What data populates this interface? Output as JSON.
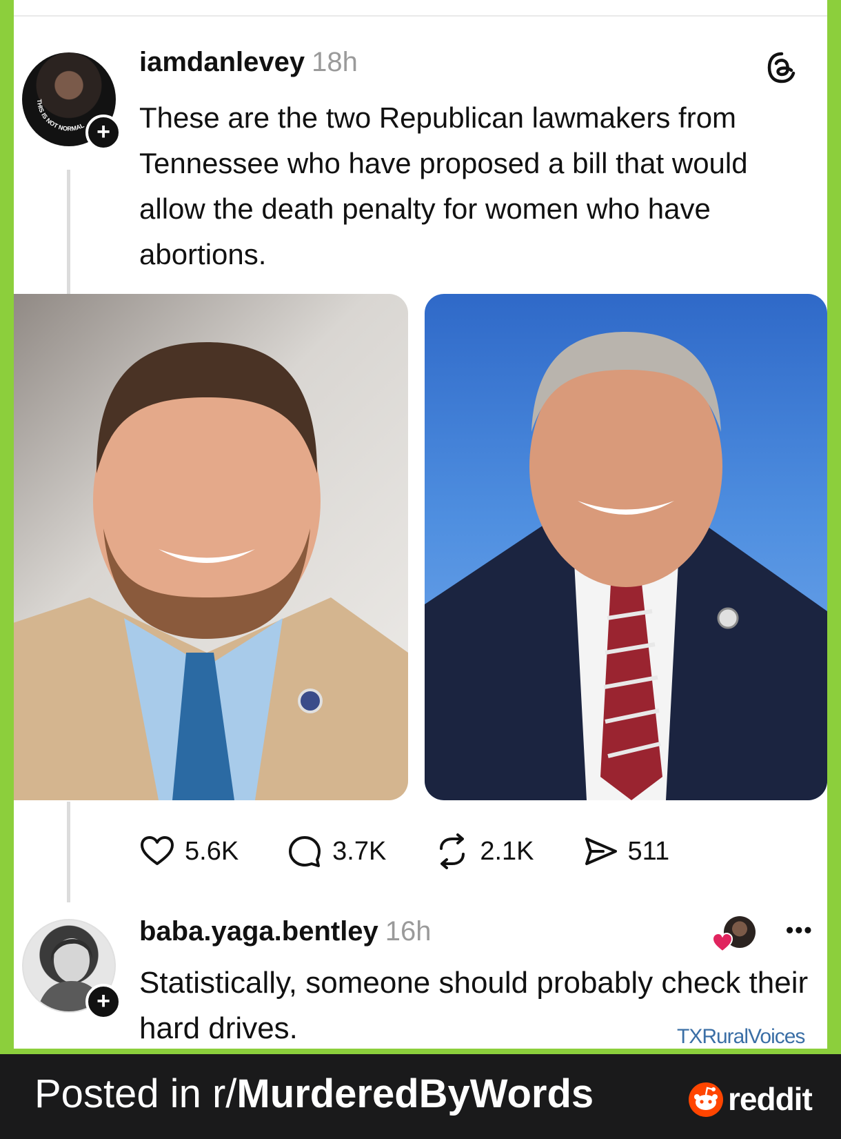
{
  "post": {
    "author": "iamdanlevey",
    "time": "18h",
    "avatar_text": "THIS IS NOT NORMAL",
    "text": "These are the two Republican lawmakers from Tennessee who have proposed a bill that would allow the death penalty for women who have abortions.",
    "icons": {
      "follow": "plus-icon",
      "app": "threads-logo-icon"
    },
    "photos": [
      "lawmaker-photo-left",
      "lawmaker-photo-right"
    ],
    "stats": {
      "likes": "5.6K",
      "comments": "3.7K",
      "reposts": "2.1K",
      "shares": "511"
    }
  },
  "reply": {
    "author": "baba.yaga.bentley",
    "time": "16h",
    "text": "Statistically, someone should probably check their hard drives.",
    "icons": {
      "reaction": "heart-icon",
      "more": "more-icon"
    }
  },
  "watermark": "TXRuralVoices",
  "footer": {
    "prefix": "Posted in r/",
    "subreddit": "MurderedByWords",
    "brand": "reddit"
  },
  "colors": {
    "frame": "#8ccf3c",
    "footer_bg": "#1a1a1b",
    "reddit_orange": "#ff4500",
    "heart_red": "#e0245e",
    "watermark": "#3b6fa6"
  }
}
